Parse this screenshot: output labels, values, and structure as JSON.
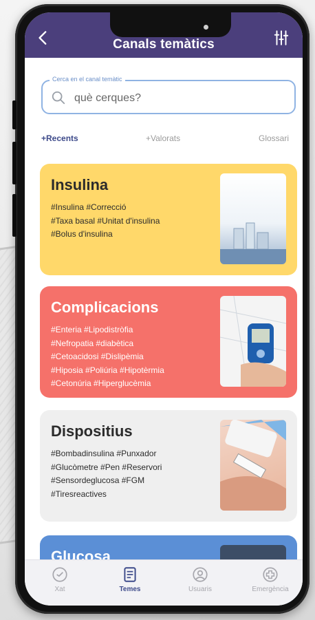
{
  "header": {
    "title": "Canals temàtics"
  },
  "search": {
    "legend": "Cerca en el canal temàtic",
    "placeholder": "què cerques?"
  },
  "tabs": [
    {
      "label": "+Recents",
      "active": true
    },
    {
      "label": "+Valorats",
      "active": false
    },
    {
      "label": "Glossari",
      "active": false
    }
  ],
  "cards": [
    {
      "title": "Insulina",
      "tags": [
        "#Insulina #Correcció",
        "#Taxa basal #Unitat d'insulina",
        "#Bolus d'insulina"
      ],
      "bg": "#ffd86a",
      "fg": "#2b2b2b"
    },
    {
      "title": "Complicacions",
      "tags": [
        "#Enteria #Lipodistròfia",
        "#Nefropatia #diabètica",
        "#Cetoacidosi #Dislipèmia",
        "#Hiposia #Poliúria #Hipotèrmia",
        "#Cetonúria #Hiperglucèmia"
      ],
      "bg": "#f5716a",
      "fg": "#ffffff"
    },
    {
      "title": "Dispositius",
      "tags": [
        "#Bombadinsulina #Punxador",
        "#Glucòmetre #Pen #Reservori",
        "#Sensordeglucosa #FGM",
        "#Tiresreactives"
      ],
      "bg": "#efefef",
      "fg": "#2b2b2b"
    },
    {
      "title": "Glucosa",
      "tags": [],
      "bg": "#5b8fd6",
      "fg": "#ffffff"
    }
  ],
  "nav": [
    {
      "label": "Xat",
      "icon": "chat-icon",
      "active": false
    },
    {
      "label": "Temes",
      "icon": "document-icon",
      "active": true
    },
    {
      "label": "Usuaris",
      "icon": "user-icon",
      "active": false
    },
    {
      "label": "Emergència",
      "icon": "emergency-icon",
      "active": false
    }
  ],
  "colors": {
    "header": "#4b3f7c",
    "accent": "#3d4a8a",
    "search_border": "#8fb3e3"
  }
}
